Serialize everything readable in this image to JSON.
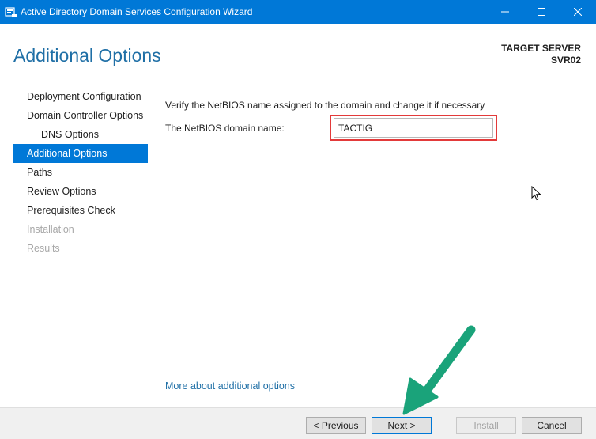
{
  "window": {
    "title": "Active Directory Domain Services Configuration Wizard"
  },
  "header": {
    "page_title": "Additional Options",
    "target_label": "TARGET SERVER",
    "target_server": "SVR02"
  },
  "nav": {
    "items": [
      {
        "label": "Deployment Configuration"
      },
      {
        "label": "Domain Controller Options"
      },
      {
        "label": "DNS Options"
      },
      {
        "label": "Additional Options"
      },
      {
        "label": "Paths"
      },
      {
        "label": "Review Options"
      },
      {
        "label": "Prerequisites Check"
      },
      {
        "label": "Installation"
      },
      {
        "label": "Results"
      }
    ]
  },
  "main": {
    "instruction": "Verify the NetBIOS name assigned to the domain and change it if necessary",
    "netbios_label": "The NetBIOS domain name:",
    "netbios_value": "TACTIG",
    "more_link": "More about additional options"
  },
  "footer": {
    "previous": "< Previous",
    "next": "Next >",
    "install": "Install",
    "cancel": "Cancel"
  },
  "colors": {
    "titlebar": "#0078d7",
    "accent_text": "#1f6fa6",
    "highlight_box": "#e33a3a",
    "annotation_arrow": "#1aa37a"
  }
}
